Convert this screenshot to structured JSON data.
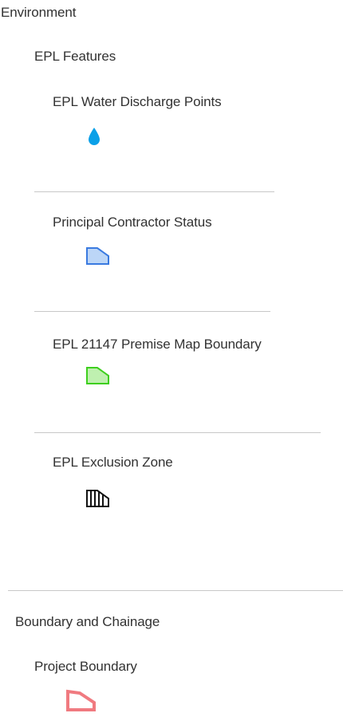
{
  "legend": {
    "environment": {
      "title": "Environment",
      "subgroup": {
        "title": "EPL Features",
        "layers": [
          {
            "label": "EPL Water Discharge Points",
            "symbol": "water-drop-icon",
            "color": "#0aa0e8"
          },
          {
            "label": "Principal Contractor Status",
            "symbol": "polygon-swatch-icon",
            "fill": "#bcd6f7",
            "stroke": "#3a7ae0"
          },
          {
            "label": "EPL 21147 Premise Map Boundary",
            "symbol": "polygon-swatch-icon",
            "fill": "#bff0b0",
            "stroke": "#3ecf1e"
          },
          {
            "label": "EPL Exclusion Zone",
            "symbol": "hatched-polygon-icon",
            "stroke": "#111111"
          }
        ]
      }
    },
    "boundary": {
      "title": "Boundary and Chainage",
      "subgroup": {
        "title": "Project Boundary",
        "symbol": "polygon-outline-icon",
        "stroke": "#f07a80"
      }
    }
  }
}
